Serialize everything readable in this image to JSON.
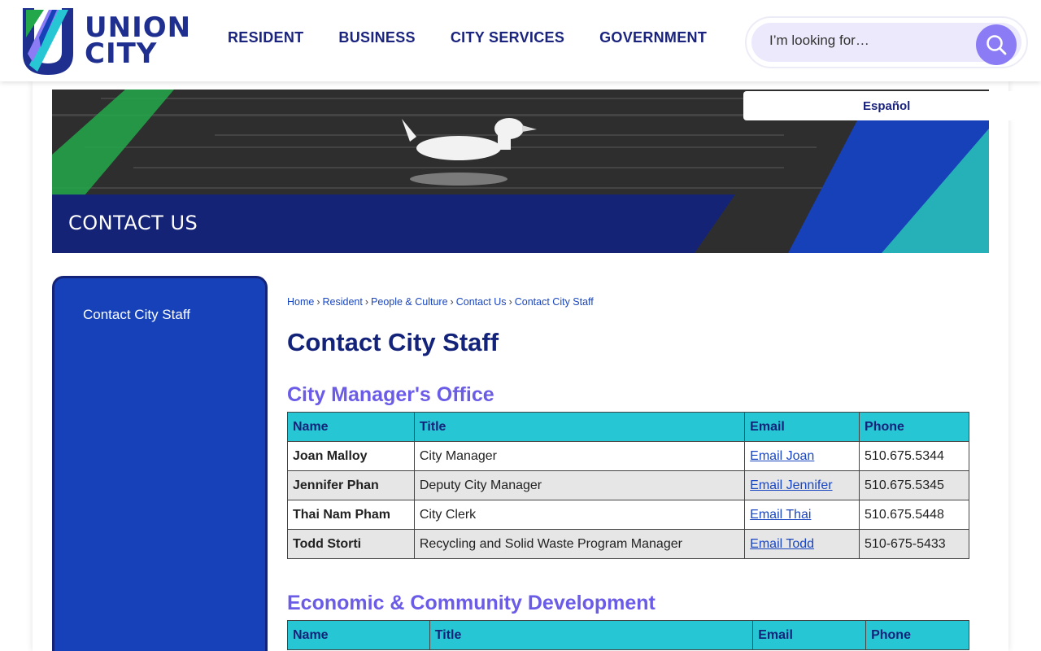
{
  "header": {
    "logo": {
      "line1": "UNION",
      "line2": "CITY"
    },
    "nav": [
      "RESIDENT",
      "BUSINESS",
      "CITY SERVICES",
      "GOVERNMENT"
    ],
    "search": {
      "placeholder": "I’m looking for…"
    }
  },
  "banner": {
    "title": "CONTACT US",
    "language_link": "Español"
  },
  "sidebar": {
    "items": [
      {
        "label": "Contact City Staff"
      }
    ]
  },
  "breadcrumb": [
    "Home",
    "Resident",
    "People & Culture",
    "Contact Us",
    "Contact City Staff"
  ],
  "page_title": "Contact City Staff",
  "sections": [
    {
      "title": "City Manager's Office",
      "headers": [
        "Name",
        "Title",
        "Email",
        "Phone"
      ],
      "rows": [
        {
          "name": "Joan Malloy",
          "title": "City Manager",
          "email": "Email Joan",
          "phone": "510.675.5344"
        },
        {
          "name": "Jennifer Phan",
          "title": "Deputy City Manager",
          "email": "Email Jennifer",
          "phone": "510.675.5345"
        },
        {
          "name": "Thai Nam Pham",
          "title": "City Clerk",
          "email": "Email Thai",
          "phone": "510.675.5448"
        },
        {
          "name": "Todd Storti",
          "title": "Recycling and Solid Waste Program Manager",
          "email": "Email Todd",
          "phone": "510-675-5433"
        }
      ]
    },
    {
      "title": "Economic & Community Development",
      "headers": [
        "Name",
        "Title",
        "Email",
        "Phone"
      ],
      "rows": []
    }
  ],
  "colors": {
    "brand_navy": "#14237a",
    "brand_blue": "#1641b8",
    "accent_purple": "#6b5ce7",
    "table_header_teal": "#26c6d4",
    "search_button": "#8b7cf6"
  },
  "icons": {
    "search": "search-icon",
    "logo_mark": "union-city-logo-mark"
  }
}
